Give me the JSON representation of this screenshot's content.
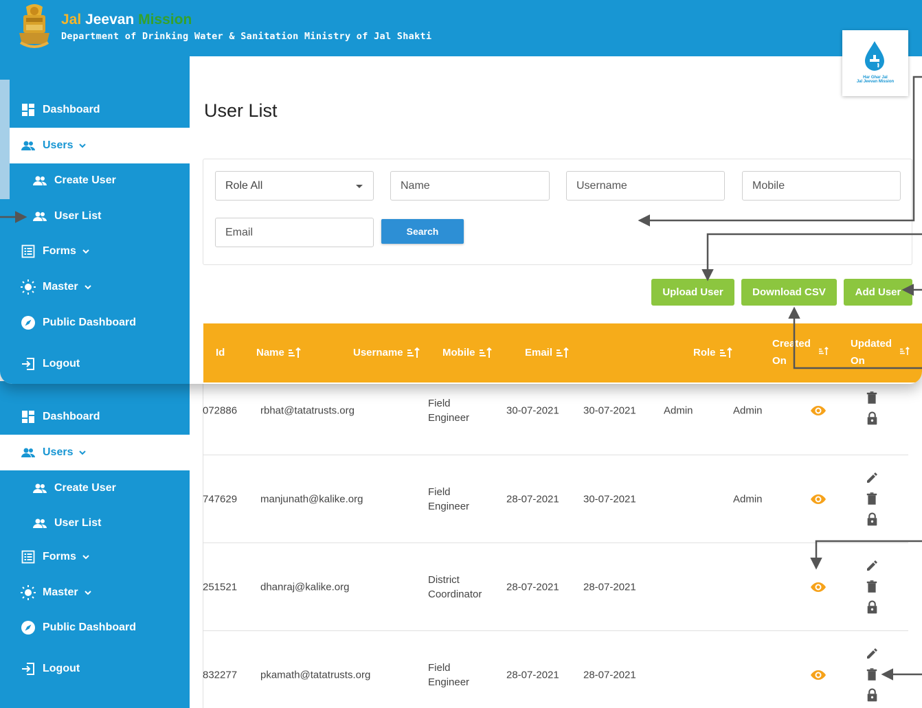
{
  "header": {
    "title_part1": "Jal",
    "title_part2": " Jeevan ",
    "title_part3": "Mission",
    "subtitle": "Department of Drinking Water & Sanitation Ministry of Jal Shakti",
    "logo_text_line1": "Har Ghar Jal",
    "logo_text_line2": "Jal Jeevan Mission"
  },
  "sidebar": {
    "items": [
      {
        "label": "Dashboard",
        "icon": "dashboard-icon"
      },
      {
        "label": "Users",
        "icon": "users-icon"
      },
      {
        "label": "Create User",
        "icon": "users-icon"
      },
      {
        "label": "User List",
        "icon": "users-icon"
      },
      {
        "label": "Forms",
        "icon": "forms-icon"
      },
      {
        "label": "Master",
        "icon": "sun-icon"
      },
      {
        "label": "Public Dashboard",
        "icon": "compass-icon"
      },
      {
        "label": "Logout",
        "icon": "logout-icon"
      }
    ]
  },
  "page": {
    "title": "User List"
  },
  "filters": {
    "role_value": "Role All",
    "name_placeholder": "Name",
    "username_placeholder": "Username",
    "mobile_placeholder": "Mobile",
    "email_placeholder": "Email",
    "search_label": "Search"
  },
  "actions": {
    "upload_label": "Upload User",
    "download_label": "Download CSV",
    "add_label": "Add User"
  },
  "table": {
    "headers": {
      "id": "Id",
      "name": "Name",
      "username": "Username",
      "mobile": "Mobile",
      "email": "Email",
      "role": "Role",
      "created_line1": "Created",
      "created_line2": "On",
      "updated_line1": "Updated",
      "updated_line2": "On"
    },
    "rows": [
      {
        "id": "072886",
        "email": "rbhat@tatatrusts.org",
        "role_line1": "Field",
        "role_line2": "Engineer",
        "created": "30-07-2021",
        "updated": "30-07-2021",
        "created_by": "Admin",
        "updated_by": "Admin"
      },
      {
        "id": "747629",
        "email": "manjunath@kalike.org",
        "role_line1": "Field",
        "role_line2": "Engineer",
        "created": "28-07-2021",
        "updated": "30-07-2021",
        "created_by": "",
        "updated_by": "Admin"
      },
      {
        "id": "251521",
        "email": "dhanraj@kalike.org",
        "role_line1": "District",
        "role_line2": "Coordinator",
        "created": "28-07-2021",
        "updated": "28-07-2021",
        "created_by": "",
        "updated_by": ""
      },
      {
        "id": "832277",
        "email": "pkamath@tatatrusts.org",
        "role_line1": "Field",
        "role_line2": "Engineer",
        "created": "28-07-2021",
        "updated": "28-07-2021",
        "created_by": "",
        "updated_by": ""
      }
    ]
  },
  "colors": {
    "brand_blue": "#1896d3",
    "header_orange": "#f6ac1a",
    "action_green": "#8cc63f",
    "search_blue": "#2d8fd5"
  }
}
